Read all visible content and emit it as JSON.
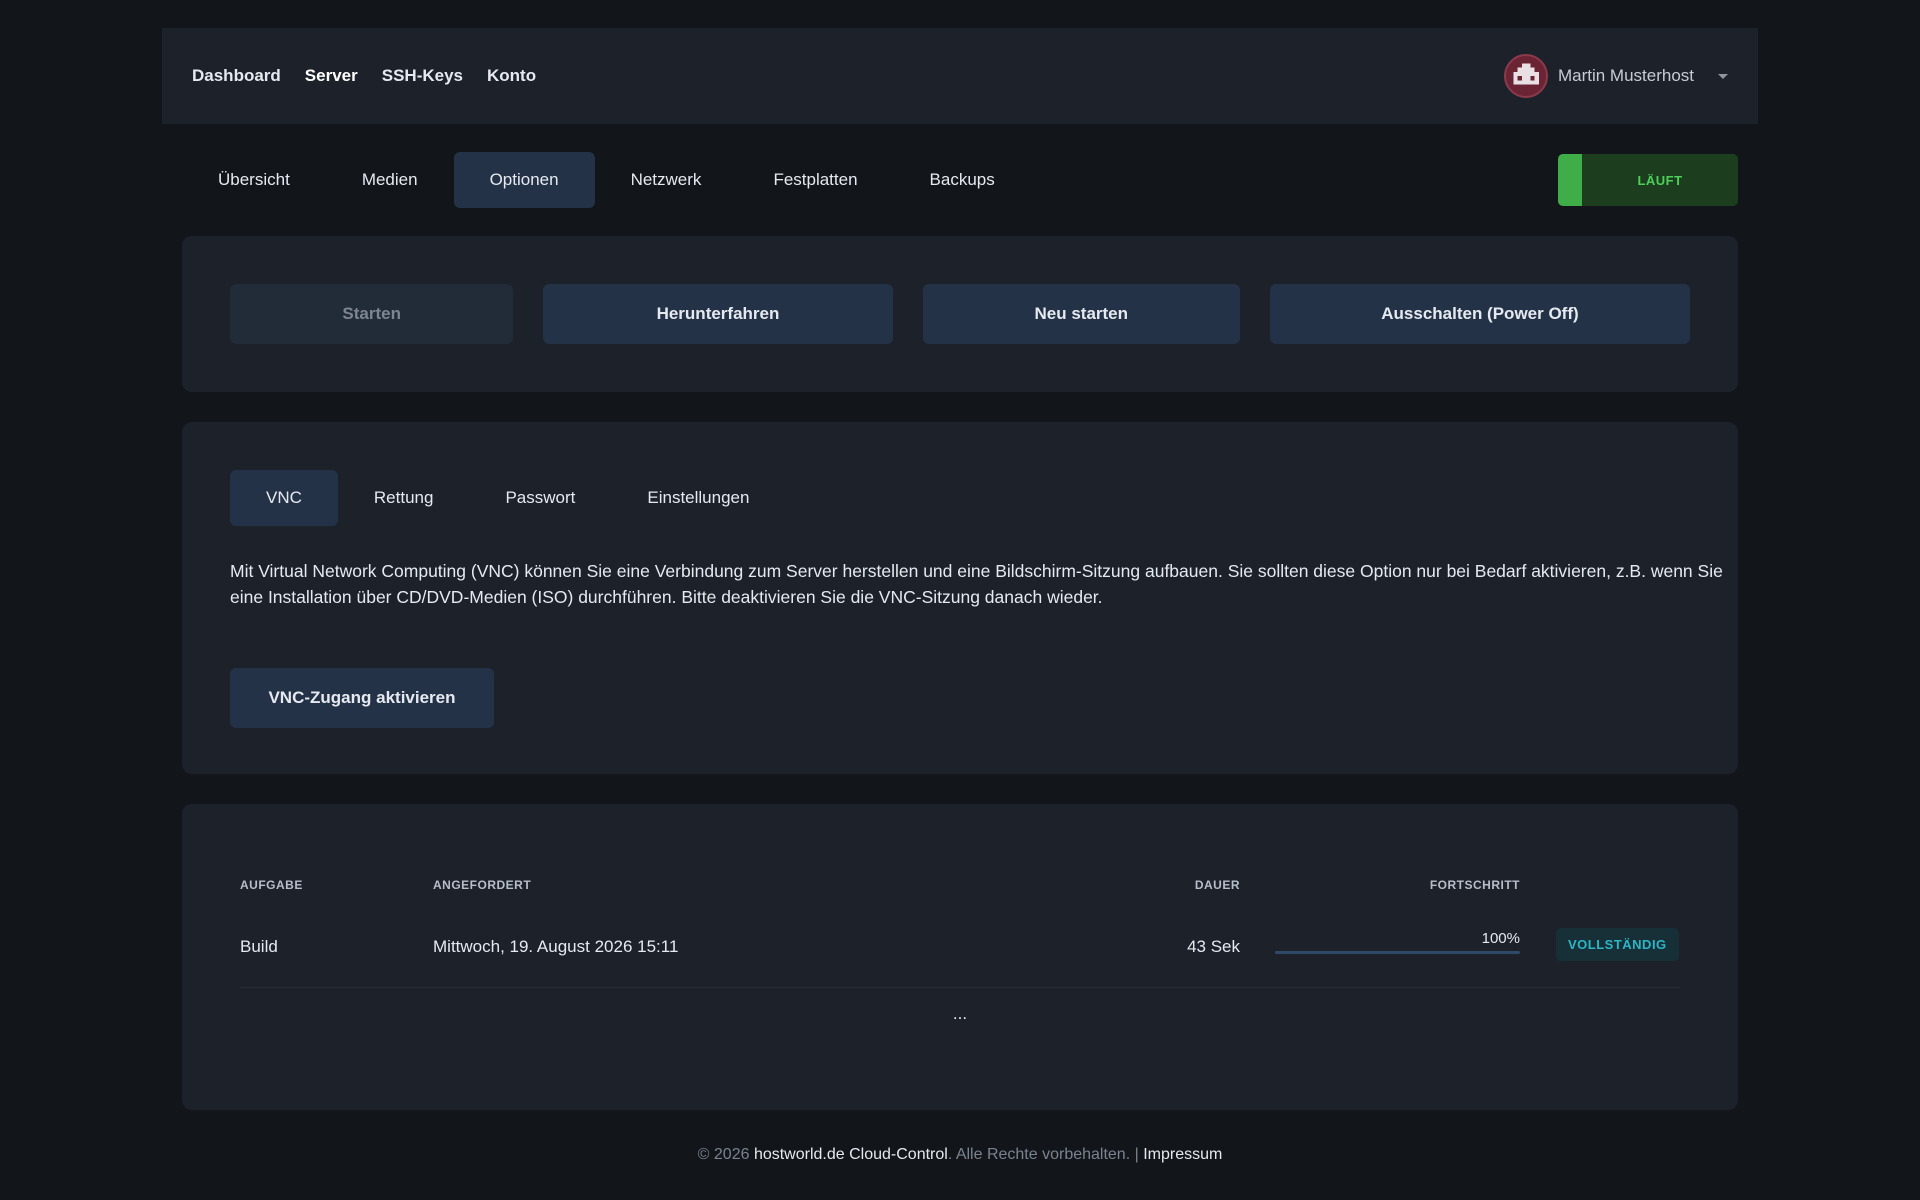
{
  "nav": {
    "links": [
      "Dashboard",
      "Server",
      "SSH-Keys",
      "Konto"
    ],
    "active": "Server",
    "user_name": "Martin Musterhost"
  },
  "subnav": {
    "tabs": [
      "Übersicht",
      "Medien",
      "Optionen",
      "Netzwerk",
      "Festplatten",
      "Backups"
    ],
    "active": "Optionen",
    "status": "LÄUFT"
  },
  "power": {
    "start": "Starten",
    "shutdown": "Herunterfahren",
    "restart": "Neu starten",
    "poweroff": "Ausschalten (Power Off)"
  },
  "vnc": {
    "tabs": [
      "VNC",
      "Rettung",
      "Passwort",
      "Einstellungen"
    ],
    "active": "VNC",
    "description": "Mit Virtual Network Computing (VNC) können Sie eine Verbindung zum Server herstellen und eine Bildschirm-Sitzung aufbauen. Sie sollten diese Option nur bei Bedarf aktivieren, z.B. wenn Sie eine Installation über CD/DVD-Medien (ISO) durchführen. Bitte deaktivieren Sie die VNC-Sitzung danach wieder.",
    "button": "VNC-Zugang aktivieren"
  },
  "tasks": {
    "headers": {
      "task": "AUFGABE",
      "requested": "ANGEFORDERT",
      "duration": "DAUER",
      "progress": "FORTSCHRITT"
    },
    "rows": [
      {
        "task": "Build",
        "requested": "Mittwoch, 19. August 2026 15:11",
        "duration": "43 Sek",
        "progress_text": "100%",
        "progress": 1.0,
        "status": "VOLLSTÄNDIG"
      }
    ],
    "more": "..."
  },
  "footer": {
    "prefix": "© 2026 ",
    "brand": "hostworld.de Cloud-Control",
    "rights": ". Alle Rechte vorbehalten. | ",
    "imprint": "Impressum"
  },
  "colors": {
    "background": "#12161b",
    "card": "#1c212a",
    "accent": "#243248",
    "status_green": "#3fae48",
    "badge_teal": "#2bb6c6"
  }
}
